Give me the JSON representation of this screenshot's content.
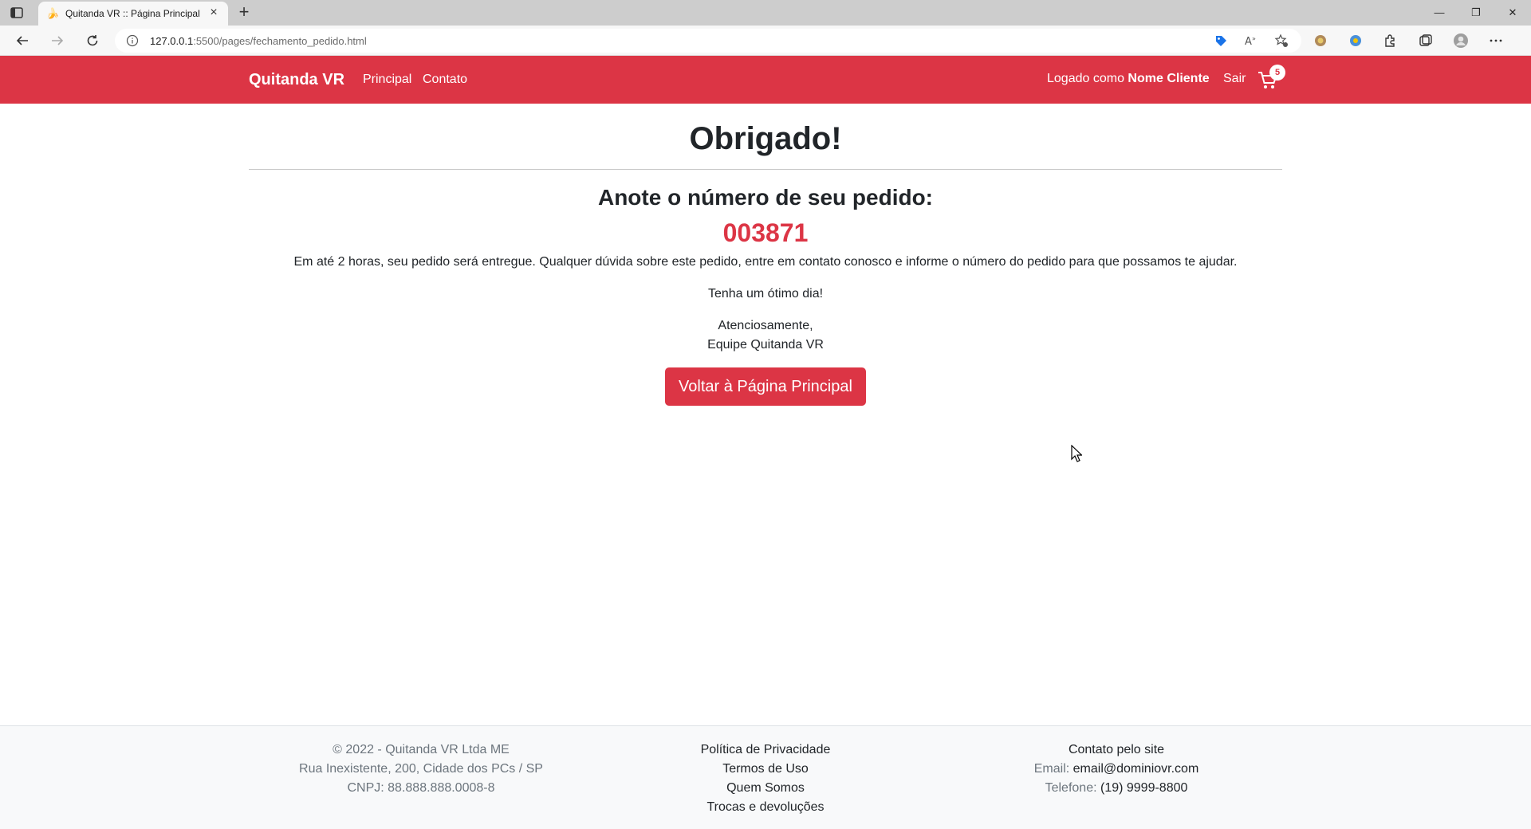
{
  "browser": {
    "tab_title": "Quitanda VR :: Página Principal",
    "url_host": "127.0.0.1",
    "url_path": ":5500/pages/fechamento_pedido.html"
  },
  "navbar": {
    "brand": "Quitanda VR",
    "links": [
      "Principal",
      "Contato"
    ],
    "logged_prefix": "Logado como",
    "user_name": "Nome Cliente",
    "logout": "Sair",
    "cart_count": "5",
    "color": "#dc3545"
  },
  "main": {
    "title": "Obrigado!",
    "subtitle": "Anote o número de seu pedido:",
    "order_number": "003871",
    "message": "Em até 2 horas, seu pedido será entregue. Qualquer dúvida sobre este pedido, entre em contato conosco e informe o número do pedido para que possamos te ajudar.",
    "greeting": "Tenha um ótimo dia!",
    "signoff_1": "Atenciosamente,",
    "signoff_2": "Equipe Quitanda VR",
    "button": "Voltar à Página Principal"
  },
  "footer": {
    "col1": [
      "© 2022 - Quitanda VR Ltda ME",
      "Rua Inexistente, 200, Cidade dos PCs / SP",
      "CNPJ: 88.888.888.0008-8"
    ],
    "col2": [
      "Política de Privacidade",
      "Termos de Uso",
      "Quem Somos",
      "Trocas e devoluções"
    ],
    "col3_title": "Contato pelo site",
    "email_label": "Email:",
    "email": "email@dominiovr.com",
    "phone_label": "Telefone:",
    "phone": "(19) 9999-8800"
  }
}
